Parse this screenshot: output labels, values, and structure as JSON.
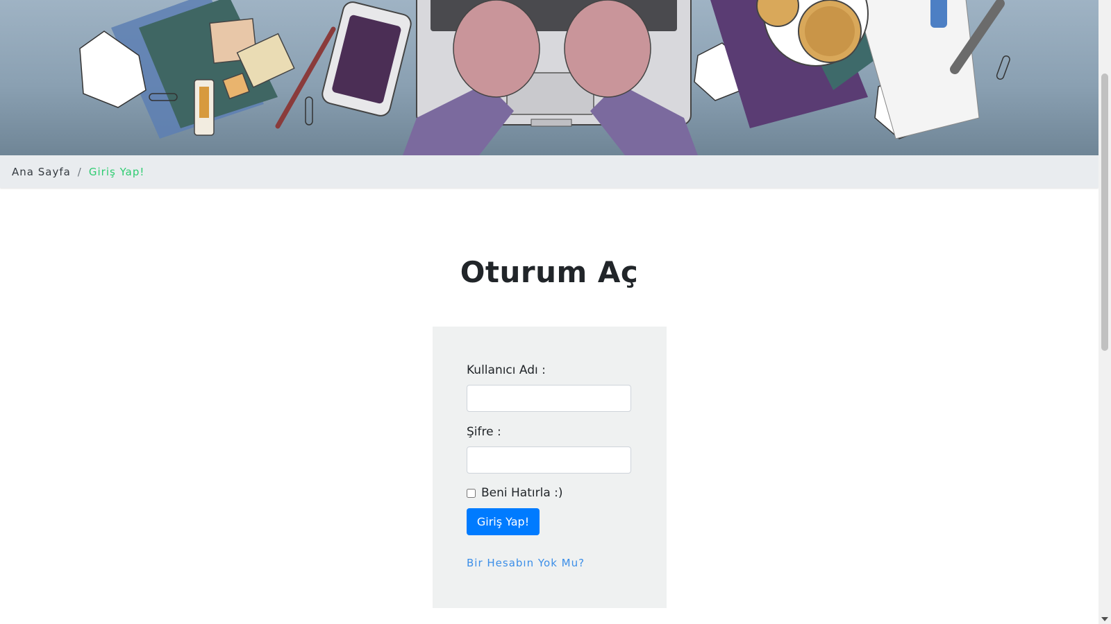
{
  "breadcrumb": {
    "home": "Ana Sayfa",
    "separator": "/",
    "current": "Giriş Yap!"
  },
  "page_title": "Oturum Aç",
  "login_form": {
    "username_label": "Kullanıcı Adı :",
    "username_value": "",
    "password_label": "Şifre :",
    "password_value": "",
    "remember_label": "Beni Hatırla :)",
    "remember_checked": false,
    "submit_label": "Giriş Yap!",
    "signup_link": "Bir Hesabın Yok Mu?"
  },
  "colors": {
    "breadcrumb_active": "#2ecc71",
    "button_primary": "#007bff",
    "link": "#3b8ee8",
    "card_background": "#eff1f1",
    "breadcrumb_background": "#e9ecef"
  },
  "icons": {
    "hero": "desk-illustration-icon",
    "scroll_down": "chevron-down-icon"
  }
}
